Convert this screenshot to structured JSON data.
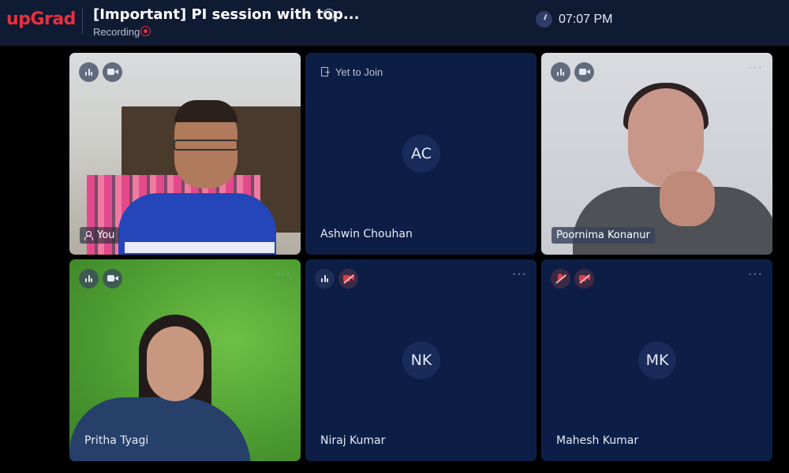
{
  "header": {
    "logo": "upGrad",
    "title": "[Important] PI session with top...",
    "status": "Recording",
    "time": "07:07 PM"
  },
  "tiles": [
    {
      "name": "You",
      "type": "video",
      "mic": "active",
      "camera": "on"
    },
    {
      "name": "Ashwin Chouhan",
      "initials": "AC",
      "status": "Yet to Join"
    },
    {
      "name": "Poornima Konanur",
      "type": "video",
      "mic": "active",
      "camera": "on"
    },
    {
      "name": "Pritha Tyagi",
      "type": "video",
      "mic": "active",
      "camera": "on"
    },
    {
      "name": "Niraj Kumar",
      "initials": "NK",
      "mic": "active",
      "camera": "off"
    },
    {
      "name": "Mahesh Kumar",
      "initials": "MK",
      "mic": "muted",
      "camera": "off"
    }
  ],
  "colors": {
    "brand": "#e8303f",
    "tile": "#0d1e46",
    "header": "#0f1a33"
  }
}
